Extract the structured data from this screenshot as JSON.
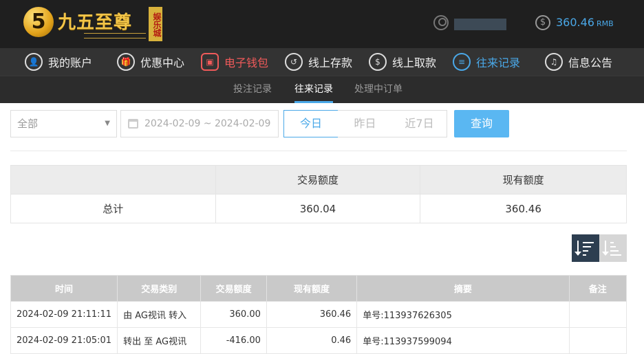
{
  "header": {
    "logo_mark": "5",
    "logo_text": "九五至尊",
    "logo_badge": "娱乐城",
    "balance": "360.46",
    "currency": "RMB"
  },
  "nav": [
    {
      "label": "我的账户",
      "icon": "user-icon",
      "glyph": "👤"
    },
    {
      "label": "优惠中心",
      "icon": "gift-icon",
      "glyph": "🎁"
    },
    {
      "label": "电子钱包",
      "icon": "wallet-icon",
      "glyph": "▣"
    },
    {
      "label": "线上存款",
      "icon": "deposit-icon",
      "glyph": "↺"
    },
    {
      "label": "线上取款",
      "icon": "withdraw-icon",
      "glyph": "$"
    },
    {
      "label": "往来记录",
      "icon": "records-icon",
      "glyph": "≡"
    },
    {
      "label": "信息公告",
      "icon": "bell-icon",
      "glyph": "♫"
    }
  ],
  "subnav": [
    "投注记录",
    "往来记录",
    "处理中订单"
  ],
  "filters": {
    "type_value": "全部",
    "date_range": "2024-02-09 ~ 2024-02-09",
    "quick": [
      "今日",
      "昨日",
      "近7日"
    ],
    "search_label": "查询"
  },
  "summary": {
    "headers": [
      "",
      "交易额度",
      "现有额度"
    ],
    "row": {
      "label": "总计",
      "trade": "360.04",
      "current": "360.46"
    }
  },
  "records": {
    "headers": [
      "时间",
      "交易类别",
      "交易额度",
      "现有额度",
      "摘要",
      "备注"
    ],
    "rows": [
      {
        "time": "2024-02-09 21:11:11",
        "type": "由 AG视讯 转入",
        "amount": "360.00",
        "balance": "360.46",
        "summary": "单号:113937626305",
        "note": ""
      },
      {
        "time": "2024-02-09 21:05:01",
        "type": "转出 至 AG视讯",
        "amount": "-416.00",
        "balance": "0.46",
        "summary": "单号:113937599094",
        "note": ""
      }
    ]
  },
  "colors": {
    "accent": "#4aa8e8",
    "alert": "#f05a5a",
    "header_bg": "#1f1f1f"
  }
}
